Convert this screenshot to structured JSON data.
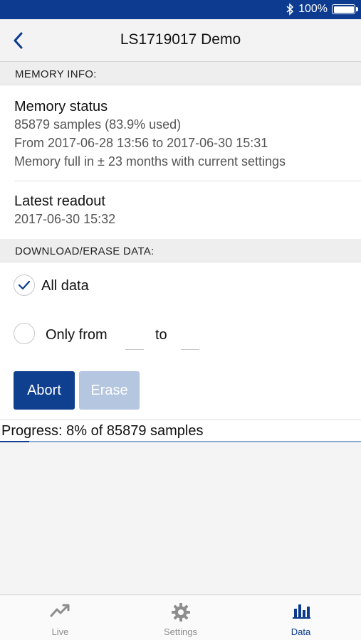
{
  "status_bar": {
    "battery_text": "100%",
    "bluetooth_icon": "bluetooth-icon",
    "battery_icon": "battery-icon"
  },
  "nav": {
    "title": "LS1719017 Demo",
    "back_icon": "chevron-left-icon"
  },
  "memory_section": {
    "header": "MEMORY INFO:",
    "status": {
      "label": "Memory status",
      "samples": "85879 samples (83.9% used)",
      "range": "From 2017-06-28 13:56 to 2017-06-30 15:31",
      "full_in": "Memory full in ± 23 months with current settings"
    },
    "latest": {
      "label": "Latest readout",
      "value": "2017-06-30 15:32"
    }
  },
  "download_section": {
    "header": "DOWNLOAD/ERASE DATA:",
    "all_data": {
      "label": "All data",
      "checked": true
    },
    "only_from": {
      "label": "Only from",
      "to_label": "to",
      "from_value": "",
      "to_value": "",
      "checked": false
    },
    "buttons": {
      "abort": "Abort",
      "erase": "Erase"
    }
  },
  "progress": {
    "text": "Progress: 8% of 85879 samples",
    "fraction": 0.08
  },
  "tabs": [
    {
      "label": "Live",
      "icon": "trend-icon",
      "active": false
    },
    {
      "label": "Settings",
      "icon": "gear-icon",
      "active": false
    },
    {
      "label": "Data",
      "icon": "bar-chart-icon",
      "active": true
    }
  ],
  "colors": {
    "accent": "#0c3b8f",
    "disabled": "#b4c6e0"
  }
}
